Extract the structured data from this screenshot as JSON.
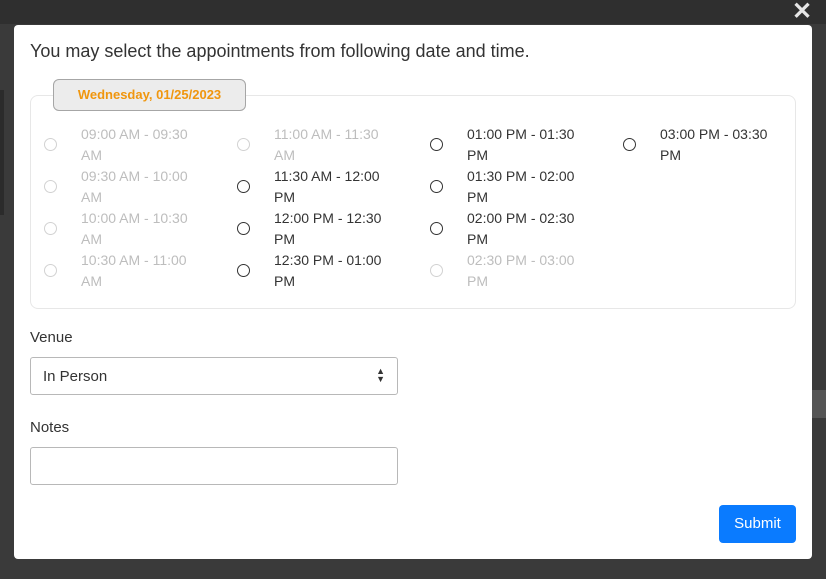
{
  "modal": {
    "heading": "You may select the appointments from following date and time.",
    "date_badge": "Wednesday, 01/25/2023",
    "slot_columns": [
      [
        {
          "line1": "09:00 AM - 09:30",
          "line2": "AM",
          "disabled": true
        },
        {
          "line1": "09:30 AM - 10:00",
          "line2": "AM",
          "disabled": true
        },
        {
          "line1": "10:00 AM - 10:30",
          "line2": "AM",
          "disabled": true
        },
        {
          "line1": "10:30 AM - 11:00",
          "line2": "AM",
          "disabled": true
        }
      ],
      [
        {
          "line1": "11:00 AM - 11:30",
          "line2": "AM",
          "disabled": true
        },
        {
          "line1": "11:30 AM - 12:00",
          "line2": "PM",
          "disabled": false
        },
        {
          "line1": "12:00 PM - 12:30",
          "line2": "PM",
          "disabled": false
        },
        {
          "line1": "12:30 PM - 01:00",
          "line2": "PM",
          "disabled": false
        }
      ],
      [
        {
          "line1": "01:00 PM - 01:30",
          "line2": "PM",
          "disabled": false
        },
        {
          "line1": "01:30 PM - 02:00",
          "line2": "PM",
          "disabled": false
        },
        {
          "line1": "02:00 PM - 02:30",
          "line2": "PM",
          "disabled": false
        },
        {
          "line1": "02:30 PM - 03:00",
          "line2": "PM",
          "disabled": true
        }
      ],
      [
        {
          "line1": "03:00 PM - 03:30",
          "line2": "PM",
          "disabled": false
        }
      ]
    ],
    "venue": {
      "label": "Venue",
      "value": "In Person"
    },
    "notes": {
      "label": "Notes",
      "value": ""
    },
    "submit_label": "Submit",
    "close_glyph": "✕"
  },
  "colors": {
    "accent": "#0a7bff",
    "date_text": "#f0960e"
  }
}
